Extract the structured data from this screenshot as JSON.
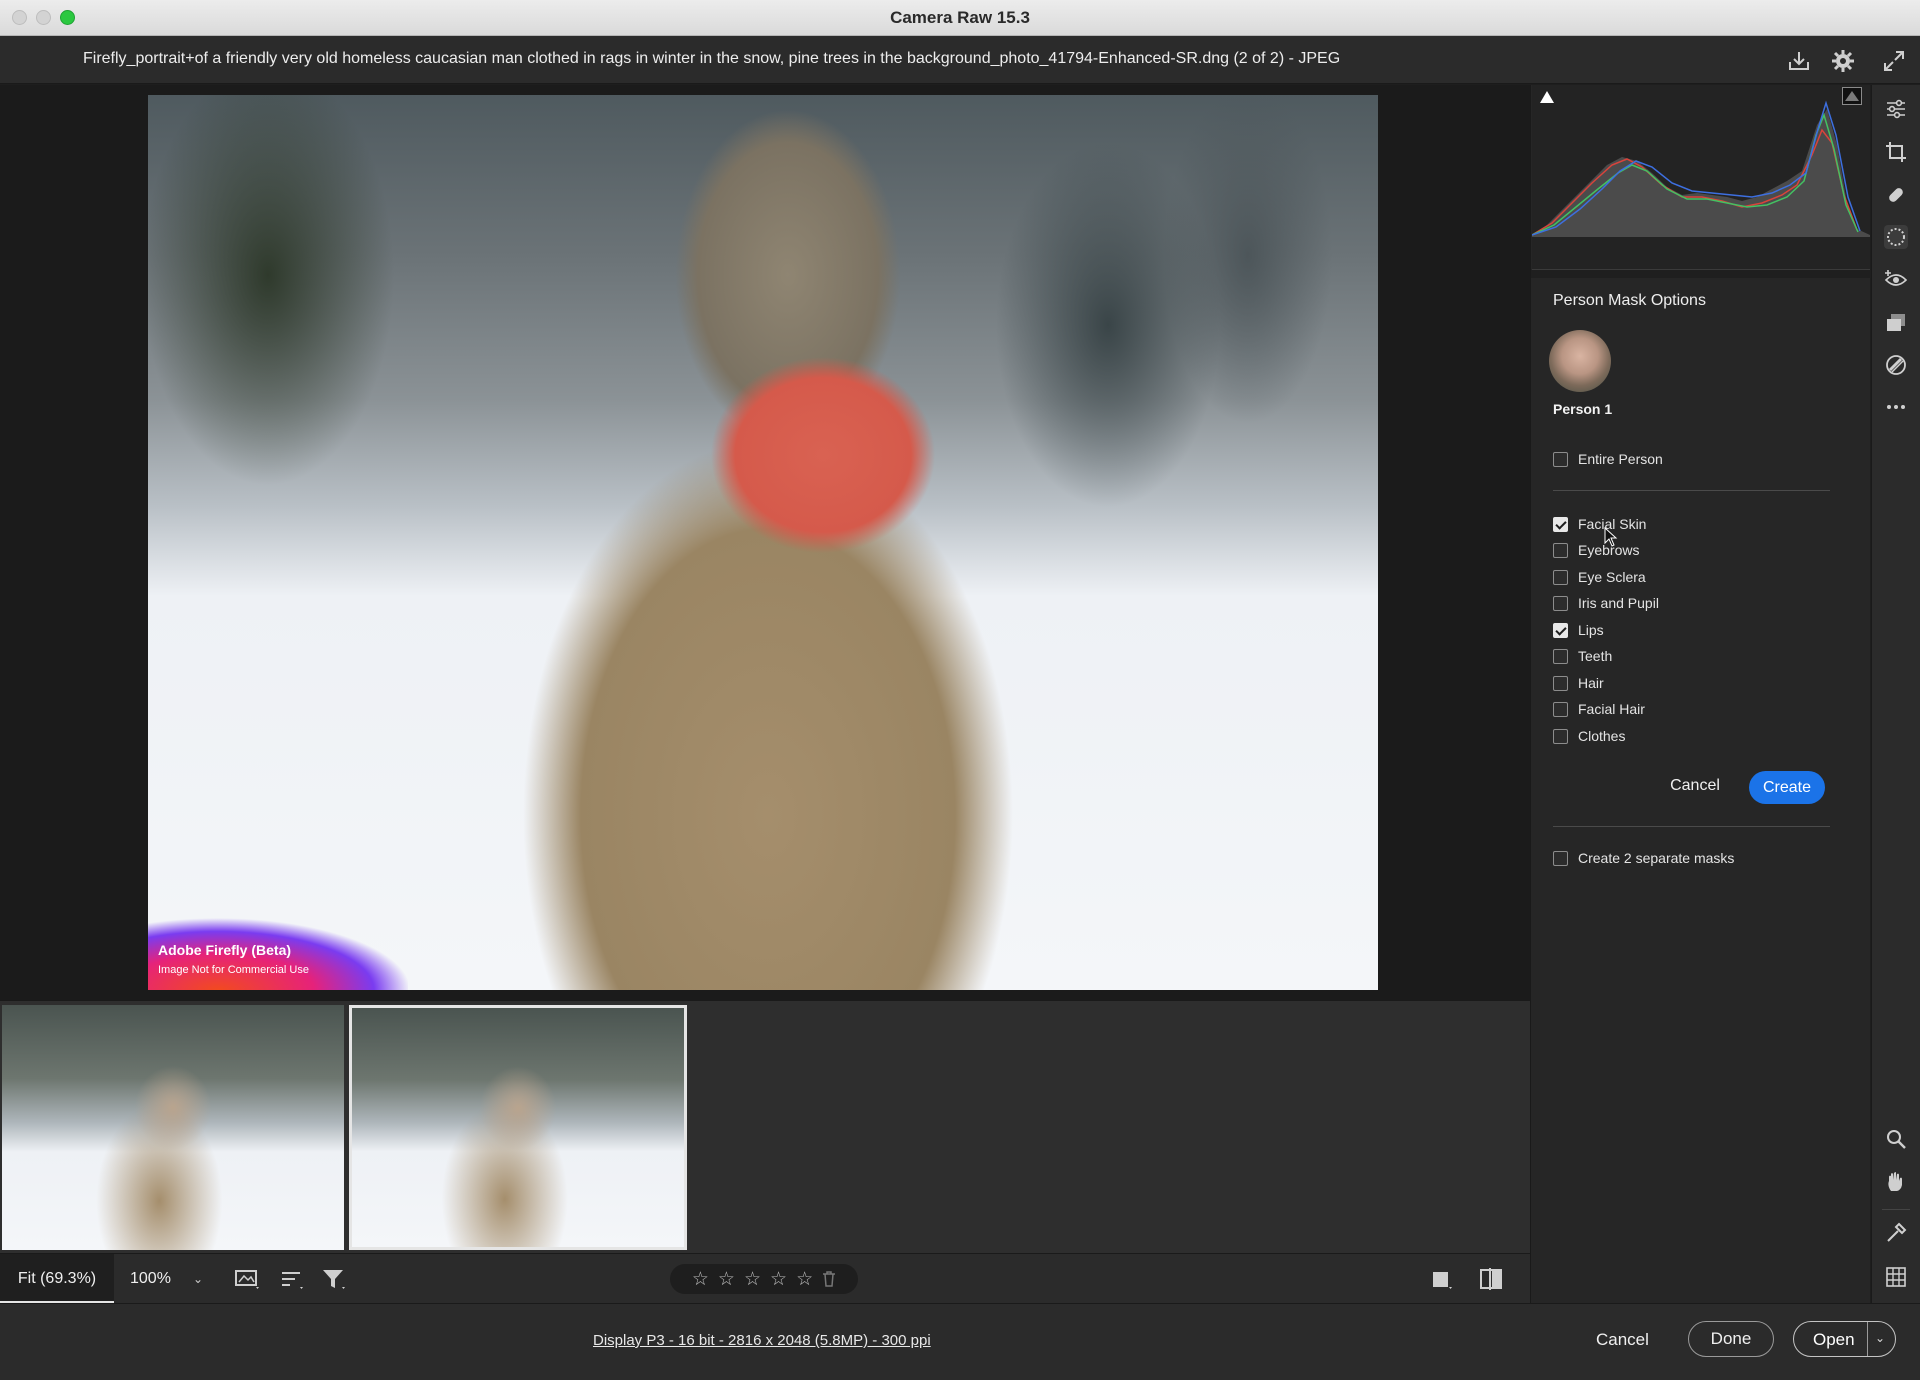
{
  "window": {
    "title": "Camera Raw 15.3"
  },
  "file_header": {
    "filename": "Firefly_portrait+of a friendly very old homeless caucasian man clothed in rags in winter in the snow, pine trees in the background_photo_41794-Enhanced-SR.dng (2 of 2)  -  JPEG",
    "icons": [
      "save-icon",
      "settings-gear-icon",
      "fullscreen-icon"
    ]
  },
  "preview": {
    "badge_brand": "Adobe Firefly (Beta)",
    "badge_note": "Image Not for Commercial Use"
  },
  "filmstrip": {
    "count": 2,
    "selected_index": 1
  },
  "toolbar": {
    "zoom_fit": "Fit (69.3%)",
    "zoom_100": "100%",
    "rating_stars": 5,
    "rating_value": 0
  },
  "status": {
    "display_info": "Display P3 - 16 bit - 2816 x 2048 (5.8MP) - 300 ppi",
    "cancel": "Cancel",
    "done": "Done",
    "open": "Open"
  },
  "mask_panel": {
    "title": "Person Mask Options",
    "person_label": "Person 1",
    "entire_person": {
      "label": "Entire Person",
      "checked": false
    },
    "parts": [
      {
        "label": "Facial Skin",
        "checked": true
      },
      {
        "label": "Eyebrows",
        "checked": false
      },
      {
        "label": "Eye Sclera",
        "checked": false
      },
      {
        "label": "Iris and Pupil",
        "checked": false
      },
      {
        "label": "Lips",
        "checked": true
      },
      {
        "label": "Teeth",
        "checked": false
      },
      {
        "label": "Hair",
        "checked": false
      },
      {
        "label": "Facial Hair",
        "checked": false
      },
      {
        "label": "Clothes",
        "checked": false
      }
    ],
    "cancel": "Cancel",
    "create": "Create",
    "separate_masks": {
      "label": "Create 2 separate masks",
      "checked": false
    }
  },
  "colors": {
    "accent": "#1b73e8",
    "mask_overlay": "#d55a4b",
    "panel_bg": "#262626"
  }
}
